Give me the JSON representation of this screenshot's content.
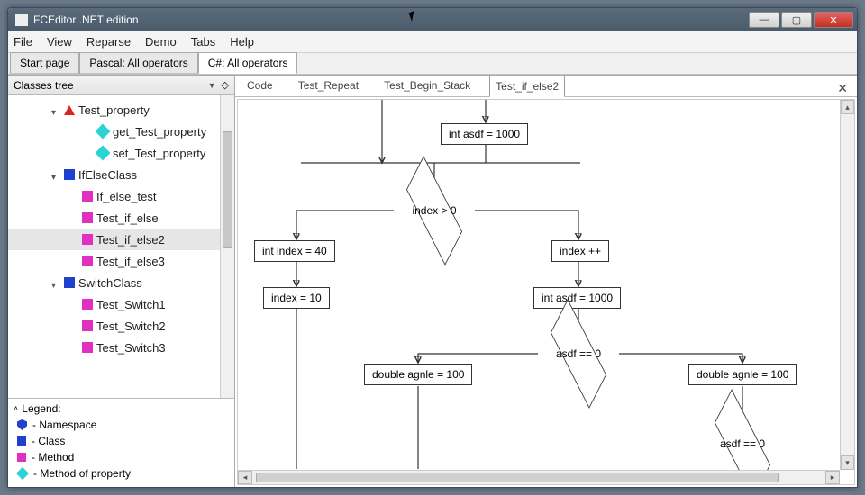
{
  "window": {
    "title": "FCEditor .NET edition"
  },
  "menu": [
    "File",
    "View",
    "Reparse",
    "Demo",
    "Tabs",
    "Help"
  ],
  "doc_tabs": [
    {
      "label": "Start page",
      "active": false
    },
    {
      "label": "Pascal: All operators",
      "active": false
    },
    {
      "label": "C#: All operators",
      "active": true
    }
  ],
  "side_header": "Classes tree",
  "tree": [
    {
      "level": 1,
      "expander": true,
      "icon": "triangle-red",
      "label": "Test_property"
    },
    {
      "level": 3,
      "icon": "diamond-cyan",
      "label": "get_Test_property"
    },
    {
      "level": 3,
      "icon": "diamond-cyan",
      "label": "set_Test_property"
    },
    {
      "level": 1,
      "expander": true,
      "icon": "square-blue",
      "label": "IfElseClass"
    },
    {
      "level": 2,
      "icon": "square-magenta",
      "label": "If_else_test"
    },
    {
      "level": 2,
      "icon": "square-magenta",
      "label": "Test_if_else"
    },
    {
      "level": 2,
      "icon": "square-magenta",
      "label": "Test_if_else2",
      "selected": true
    },
    {
      "level": 2,
      "icon": "square-magenta",
      "label": "Test_if_else3"
    },
    {
      "level": 1,
      "expander": true,
      "icon": "square-blue",
      "label": "SwitchClass"
    },
    {
      "level": 2,
      "icon": "square-magenta",
      "label": "Test_Switch1"
    },
    {
      "level": 2,
      "icon": "square-magenta",
      "label": "Test_Switch2"
    },
    {
      "level": 2,
      "icon": "square-magenta",
      "label": "Test_Switch3"
    }
  ],
  "legend": {
    "title": "Legend:",
    "items": [
      {
        "icon": "shield-blue",
        "label": "- Namespace"
      },
      {
        "icon": "square-blue",
        "label": "- Class"
      },
      {
        "icon": "square-magenta",
        "label": "- Method"
      },
      {
        "icon": "diamond-cyan",
        "label": "- Method of property"
      }
    ]
  },
  "sub_tabs": [
    {
      "label": "Code",
      "active": false
    },
    {
      "label": "Test_Repeat",
      "active": false
    },
    {
      "label": "Test_Begin_Stack",
      "active": false
    },
    {
      "label": "Test_if_else2",
      "active": true
    }
  ],
  "flow": {
    "box_init": "int  asdf =  1000",
    "cond_index": "index >  0",
    "box_idx40": "int  index =  40",
    "box_idxinc": "index ++",
    "box_idx10": "index  =  10",
    "box_asdfset": "int  asdf =  1000",
    "cond_asdf": "asdf ==  0",
    "box_agnle_l": "double  agnle =  100",
    "box_agnle_r": "double  agnle =  100",
    "cond_asdf2": "asdf ==  0"
  }
}
